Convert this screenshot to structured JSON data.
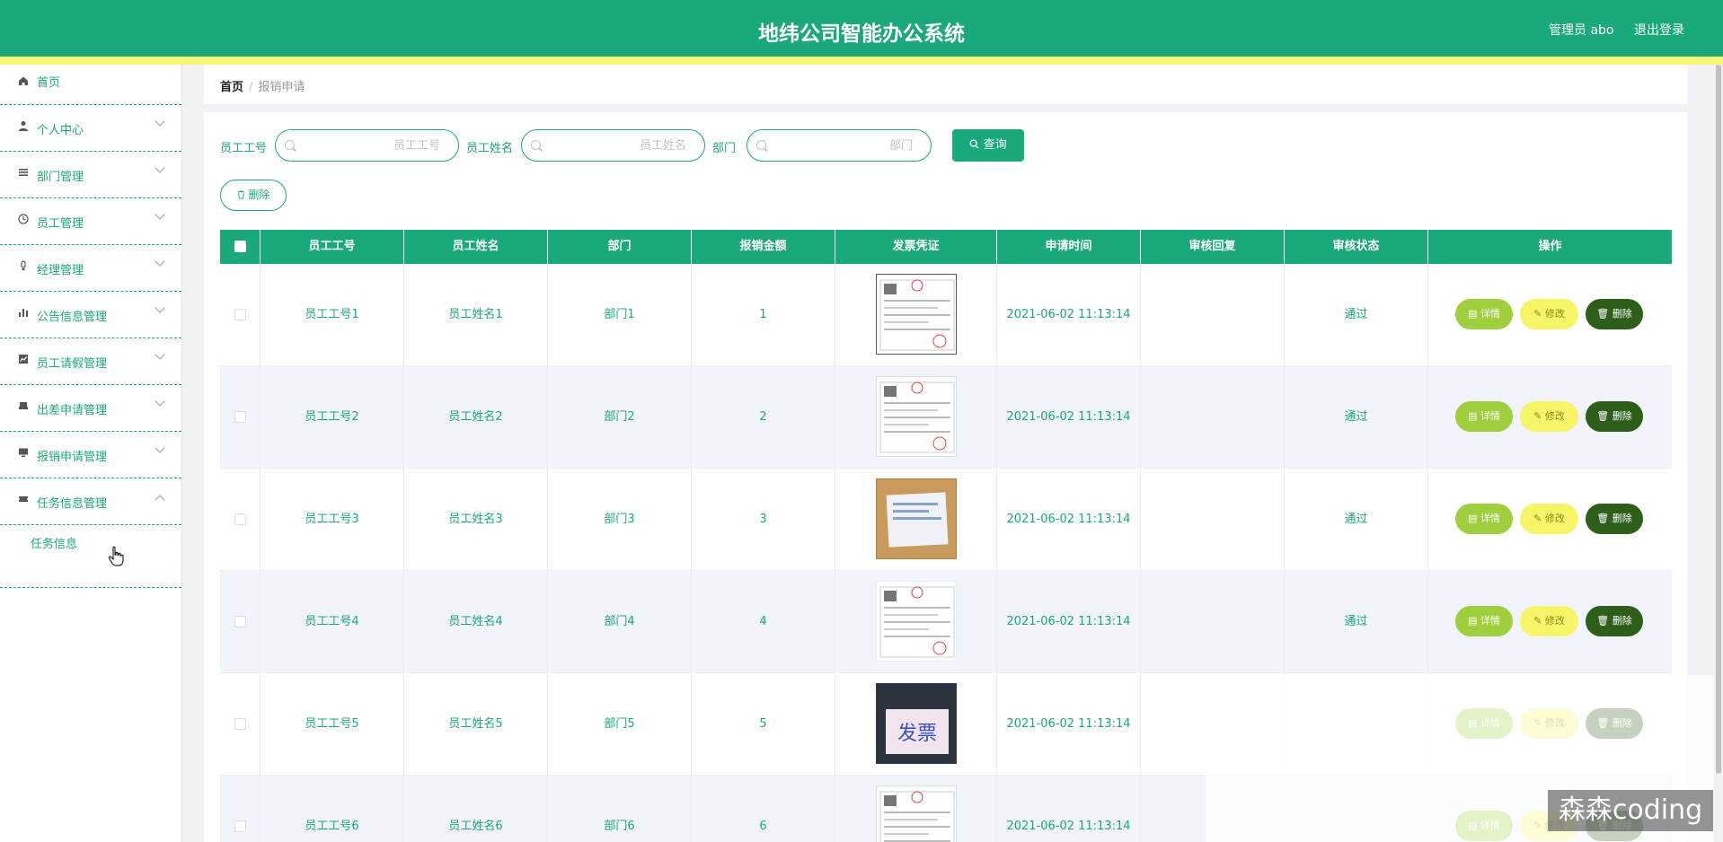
{
  "header": {
    "title": "地纬公司智能办公系统",
    "user": "管理员 abo",
    "logout": "退出登录"
  },
  "sidebar": {
    "items": [
      {
        "label": "首页",
        "icon": "home-icon"
      },
      {
        "label": "个人中心",
        "icon": "user-icon"
      },
      {
        "label": "部门管理",
        "icon": "list-icon"
      },
      {
        "label": "员工管理",
        "icon": "clock-icon"
      },
      {
        "label": "经理管理",
        "icon": "bulb-icon"
      },
      {
        "label": "公告信息管理",
        "icon": "bar-chart-icon"
      },
      {
        "label": "员工请假管理",
        "icon": "line-chart-icon"
      },
      {
        "label": "出差申请管理",
        "icon": "sofa-icon"
      },
      {
        "label": "报销申请管理",
        "icon": "monitor-icon"
      },
      {
        "label": "任务信息管理",
        "icon": "ticket-icon"
      }
    ],
    "submenu": {
      "label": "任务信息"
    }
  },
  "breadcrumb": {
    "home": "首页",
    "separator": "/",
    "current": "报销申请"
  },
  "search": {
    "fields": [
      {
        "label": "员工工号",
        "placeholder": "员工工号"
      },
      {
        "label": "员工姓名",
        "placeholder": "员工姓名"
      },
      {
        "label": "部门",
        "placeholder": "部门"
      }
    ],
    "query_label": "查询",
    "delete_label": "删除"
  },
  "table": {
    "headers": [
      "员工工号",
      "员工姓名",
      "部门",
      "报销金额",
      "发票凭证",
      "申请时间",
      "审核回复",
      "审核状态",
      "操作"
    ],
    "rows": [
      {
        "id": "员工工号1",
        "name": "员工姓名1",
        "dept": "部门1",
        "amount": "1",
        "time": "2021-06-02 11:13:14",
        "reply": "",
        "status": "通过"
      },
      {
        "id": "员工工号2",
        "name": "员工姓名2",
        "dept": "部门2",
        "amount": "2",
        "time": "2021-06-02 11:13:14",
        "reply": "",
        "status": "通过"
      },
      {
        "id": "员工工号3",
        "name": "员工姓名3",
        "dept": "部门3",
        "amount": "3",
        "time": "2021-06-02 11:13:14",
        "reply": "",
        "status": "通过"
      },
      {
        "id": "员工工号4",
        "name": "员工姓名4",
        "dept": "部门4",
        "amount": "4",
        "time": "2021-06-02 11:13:14",
        "reply": "",
        "status": "通过"
      },
      {
        "id": "员工工号5",
        "name": "员工姓名5",
        "dept": "部门5",
        "amount": "5",
        "time": "2021-06-02 11:13:14",
        "reply": "",
        "status": ""
      },
      {
        "id": "员工工号6",
        "name": "员工姓名6",
        "dept": "部门6",
        "amount": "6",
        "time": "2021-06-02 11:13:14",
        "reply": "",
        "status": ""
      }
    ],
    "actions": {
      "detail": "详情",
      "edit": "修改",
      "delete": "删除"
    }
  },
  "watermark": "森森coding",
  "colors": {
    "primary": "#1aa97a",
    "accent_bar": "#f6f475",
    "detail": "#9fcf3c",
    "edit": "#f7f567",
    "delete": "#2d5e1a"
  }
}
